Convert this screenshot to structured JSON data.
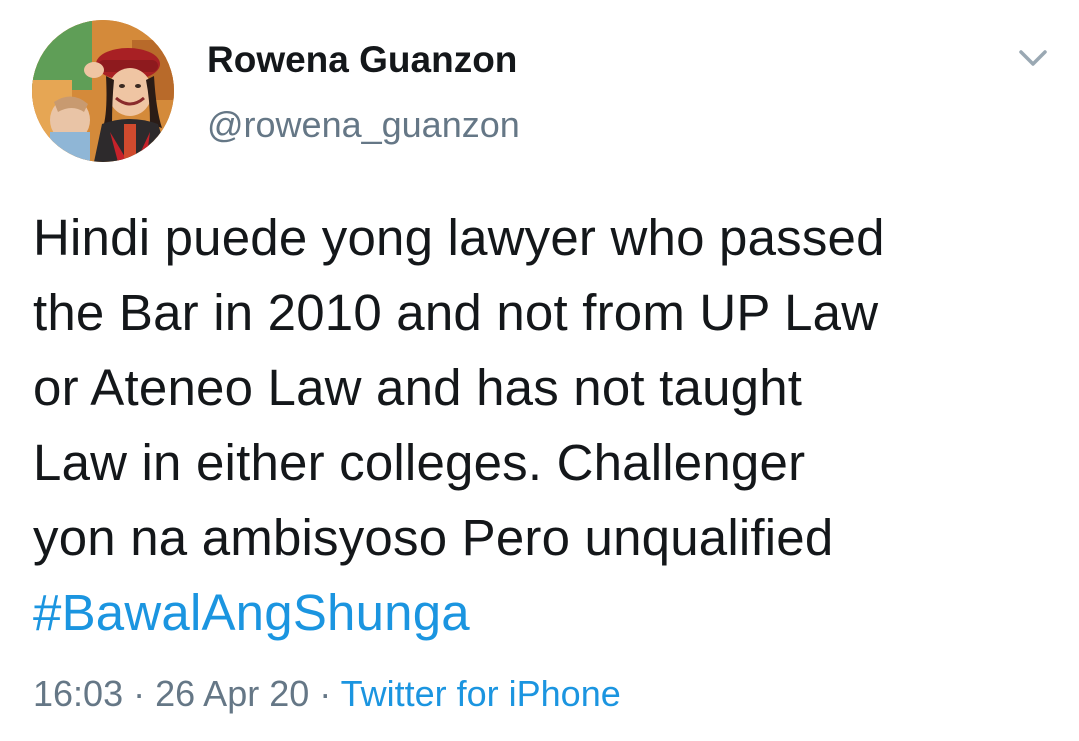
{
  "tweet": {
    "author": {
      "display_name": "Rowena Guanzon",
      "handle": "@rowena_guanzon",
      "avatar_icon": "profile-photo"
    },
    "menu_icon": "chevron-down-icon",
    "text_lines": [
      "Hindi puede yong lawyer who passed",
      "the Bar in 2010 and not from UP Law",
      "or Ateneo Law and has not taught",
      "Law in either colleges. Challenger",
      "yon na ambisyoso Pero unqualified"
    ],
    "hashtag": "#BawalAngShunga",
    "time": "16:03",
    "separator": "·",
    "date": "26 Apr 20",
    "source": "Twitter for iPhone"
  },
  "colors": {
    "text": "#14171a",
    "secondary": "#657786",
    "link": "#1b95e0",
    "chevron": "#9aa8b3"
  }
}
